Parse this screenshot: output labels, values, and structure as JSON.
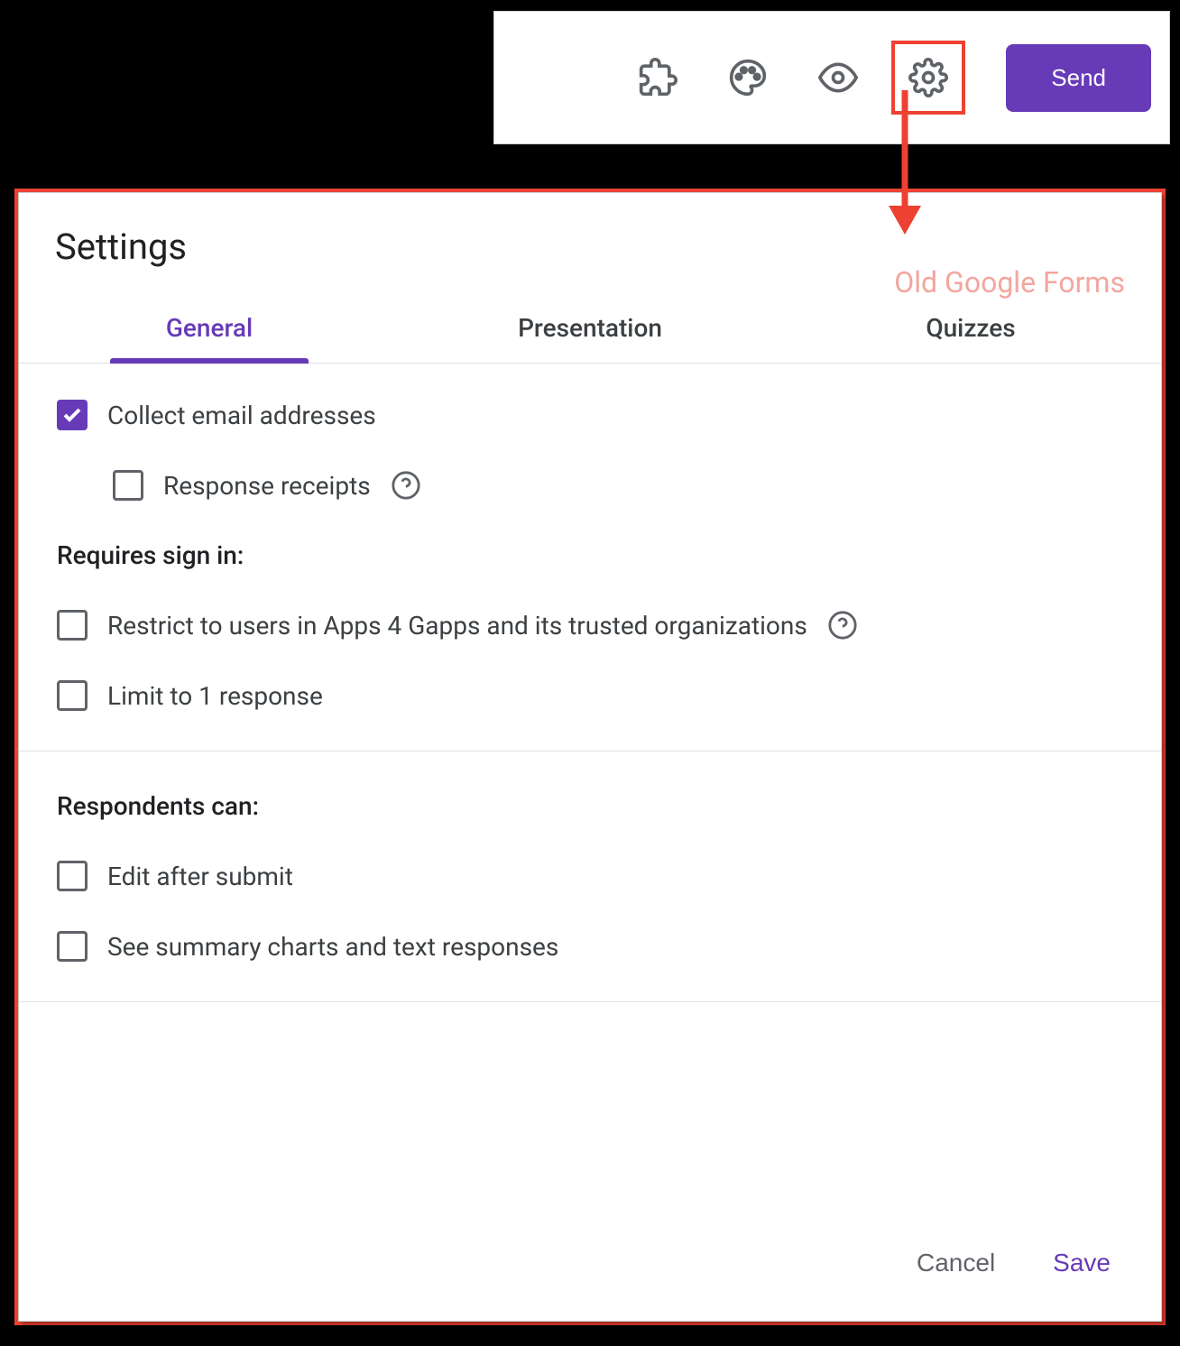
{
  "toolbar": {
    "send_label": "Send"
  },
  "annotation": {
    "watermark": "Old Google Forms"
  },
  "dialog": {
    "title": "Settings",
    "tabs": {
      "general": "General",
      "presentation": "Presentation",
      "quizzes": "Quizzes"
    },
    "options": {
      "collect_email": "Collect email addresses",
      "response_receipts": "Response receipts",
      "section_signin": "Requires sign in:",
      "restrict": "Restrict to users in Apps 4 Gapps and its trusted organizations",
      "limit1": "Limit to 1 response",
      "section_respondents": "Respondents can:",
      "edit_after": "Edit after submit",
      "see_summary": "See summary charts and text responses"
    },
    "footer": {
      "cancel": "Cancel",
      "save": "Save"
    }
  }
}
